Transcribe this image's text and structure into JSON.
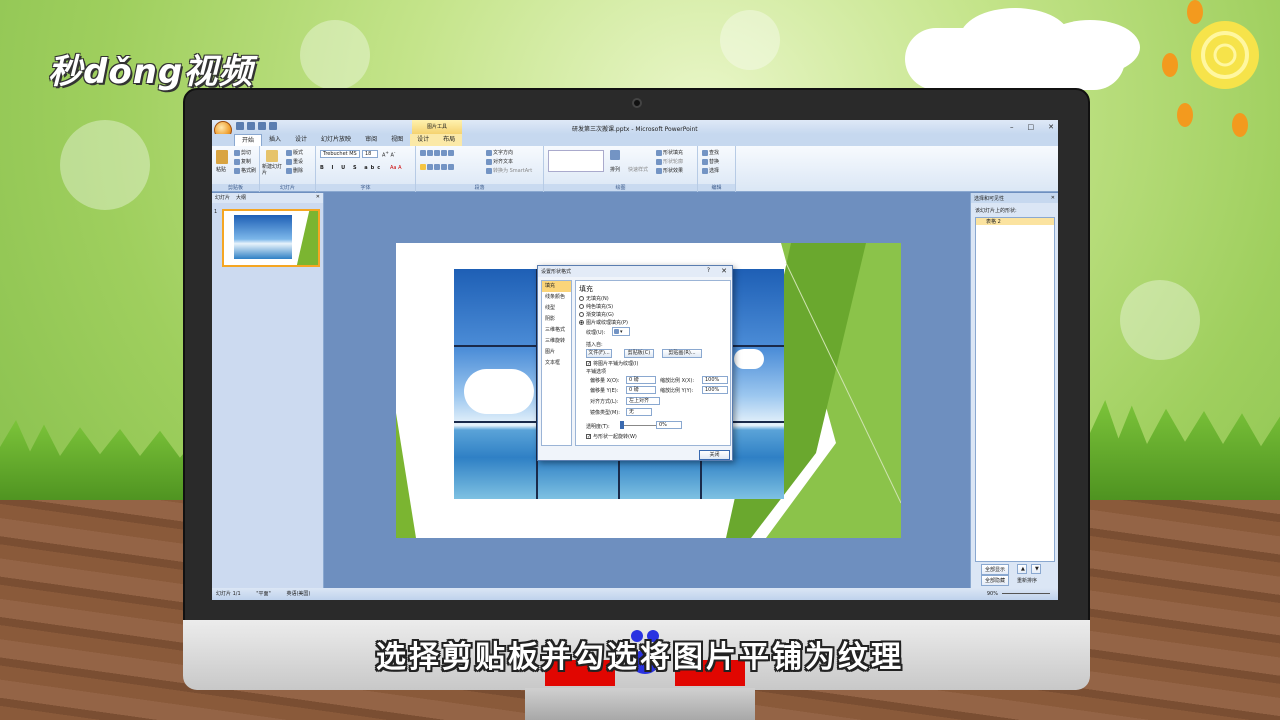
{
  "watermark_logo": "秒dǒng视频",
  "caption": "选择剪贴板并勾选将图片平铺为纹理",
  "app": {
    "window_title": "研发第三次搬课.pptx - Microsoft PowerPoint",
    "context_tab": "图片工具",
    "tabs": [
      "开始",
      "插入",
      "设计",
      "幻灯片放映",
      "审阅",
      "视图",
      "设计",
      "布局"
    ],
    "active_tab": "开始",
    "ribbon": {
      "clipboard": {
        "label": "剪贴板",
        "paste": "粘贴",
        "cut": "剪切",
        "copy": "复制",
        "format_painter": "格式刷"
      },
      "slides": {
        "label": "幻灯片",
        "new_slide": "新建幻灯片",
        "layout": "版式",
        "reset": "重设",
        "delete": "删除"
      },
      "font": {
        "label": "字体",
        "font_name": "Trebuchet MS",
        "font_size": "18"
      },
      "paragraph": {
        "label": "段落",
        "text_direction": "文字方向",
        "align_text": "对齐文本",
        "smartart": "转换为 SmartArt"
      },
      "drawing": {
        "label": "绘图",
        "arrange": "排列",
        "quick_styles": "快速样式",
        "shape_fill": "形状填充",
        "shape_outline": "形状轮廓",
        "shape_effects": "形状效果"
      },
      "editing": {
        "label": "编辑",
        "find": "查找",
        "replace": "替换",
        "select": "选择"
      }
    },
    "left_pane": {
      "tab_slides": "幻灯片",
      "tab_outline": "大纲",
      "slide_number": "1"
    },
    "right_pane": {
      "title": "选择和可见性",
      "subtitle": "该幻灯片上的形状:",
      "item": "表格 2",
      "show_all": "全部显示",
      "hide_all": "全部隐藏",
      "reorder": "重新排序"
    },
    "status": {
      "slide": "幻灯片 1/1",
      "theme": "\"平面\"",
      "language": "英语(美国)",
      "zoom": "90%"
    }
  },
  "dialog": {
    "title": "设置形状格式",
    "nav": [
      "填充",
      "线条颜色",
      "线型",
      "阴影",
      "三维格式",
      "三维旋转",
      "图片",
      "文本框"
    ],
    "selected_nav": "填充",
    "section": "填充",
    "options": [
      "无填充(N)",
      "纯色填充(S)",
      "渐变填充(G)",
      "图片或纹理填充(P)"
    ],
    "selected_option": "图片或纹理填充(P)",
    "texture_label": "纹理(U):",
    "insert_from": "插入自:",
    "btn_file": "文件(F)...",
    "btn_clipboard": "剪贴板(C)",
    "btn_clipart": "剪贴画(R)...",
    "tile_checkbox": "将图片平铺为纹理(I)",
    "tile_checked": true,
    "tile_options": "平铺选项",
    "offset_x_label": "偏移量 X(O):",
    "offset_x": "0 磅",
    "offset_y_label": "偏移量 Y(E):",
    "offset_y": "0 磅",
    "scale_x_label": "缩放比例 X(X):",
    "scale_x": "100%",
    "scale_y_label": "缩放比例 Y(Y):",
    "scale_y": "100%",
    "alignment_label": "对齐方式(L):",
    "alignment": "左上对齐",
    "mirror_label": "镜像类型(M):",
    "mirror": "无",
    "transparency_label": "透明度(T):",
    "transparency": "0%",
    "transparency_value": 0,
    "rotate_checkbox": "与形状一起旋转(W)",
    "rotate_checked": true,
    "close": "关闭"
  },
  "colors": {
    "ribbon": "#dbe7f5",
    "accent": "#f5a623",
    "slide_green": "#7bb531"
  }
}
